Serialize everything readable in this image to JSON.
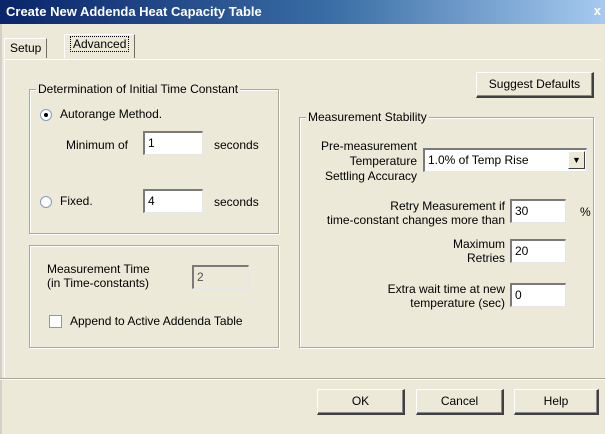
{
  "window": {
    "title": "Create New Addenda Heat Capacity Table",
    "close_glyph": "x"
  },
  "tabs": [
    {
      "label": "Setup"
    },
    {
      "label": "Advanced"
    }
  ],
  "initial_time_constant": {
    "legend": "Determination of Initial Time Constant",
    "autorange_label": "Autorange Method.",
    "autorange_selected": true,
    "minimum_label": "Minimum of",
    "minimum_value": "1",
    "minimum_unit": "seconds",
    "fixed_label": "Fixed.",
    "fixed_selected": false,
    "fixed_value": "4",
    "fixed_unit": "seconds"
  },
  "measurement_time": {
    "label_line1": "Measurement Time",
    "label_line2": "(in Time-constants)",
    "value": "2",
    "append_label": "Append to Active Addenda Table",
    "append_checked": false
  },
  "suggest_defaults_label": "Suggest Defaults",
  "stability": {
    "legend": "Measurement Stability",
    "pre_label_1": "Pre-measurement",
    "pre_label_2": "Temperature",
    "pre_label_3": "Settling Accuracy",
    "pre_value": "1.0% of Temp Rise",
    "retry_label_1": "Retry Measurement if",
    "retry_label_2": "time-constant changes more than",
    "retry_value": "30",
    "retry_unit": "%",
    "max_label_1": "Maximum",
    "max_label_2": "Retries",
    "max_value": "20",
    "wait_label_1": "Extra wait time at new",
    "wait_label_2": "temperature (sec)",
    "wait_value": "0"
  },
  "buttons": {
    "ok": "OK",
    "cancel": "Cancel",
    "help": "Help"
  },
  "colors": {
    "title_start": "#0a246a",
    "title_end": "#a6caf0",
    "face": "#ece9d8"
  },
  "icons": {
    "dropdown": "chevron-down-icon"
  }
}
